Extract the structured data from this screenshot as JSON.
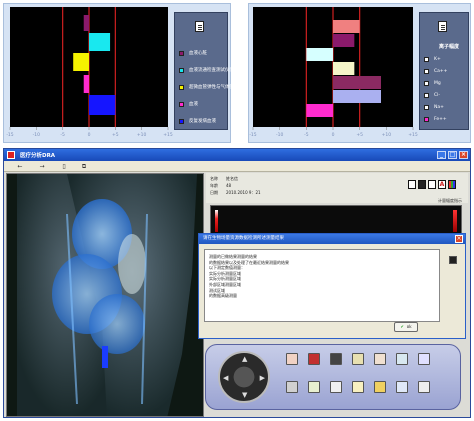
{
  "chart_data": [
    {
      "type": "bar",
      "orientation": "horizontal",
      "categories": [
        "血液心脏",
        "血液流通检查测试仪值测量",
        "超微血管弹性与气体弹性",
        "血液",
        "反复发病血液"
      ],
      "values": [
        -1,
        4,
        -3,
        -1,
        5
      ],
      "colors": [
        "#8b1a6b",
        "#19e8ef",
        "#f5f200",
        "#ff2bcf",
        "#1515ff"
      ],
      "xlim": [
        -15,
        15
      ],
      "xticks": [
        -15,
        -10,
        -5,
        0,
        5,
        10,
        15
      ],
      "xtick_labels": [
        "-15",
        "-10",
        "-5",
        "0",
        "+5",
        "+10",
        "+15"
      ],
      "reference_lines": [
        -5,
        0,
        5
      ]
    },
    {
      "type": "bar",
      "orientation": "horizontal",
      "title": "离子幅度",
      "categories": [
        "K+",
        "Ca++",
        "Mg",
        "Cl-",
        "Na+",
        "Fe++"
      ],
      "bars": [
        {
          "start": 0,
          "end": 5,
          "color": "#f08080"
        },
        {
          "start": 0,
          "end": 4,
          "color": "#8b1a6b"
        },
        {
          "start": -5,
          "end": 0,
          "color": "#d6ffff"
        },
        {
          "start": 0,
          "end": 4,
          "color": "#f5f5c8"
        },
        {
          "start": 0,
          "end": 9,
          "color": "#8b2a62"
        },
        {
          "start": 0,
          "end": 9,
          "color": "#aab0f0"
        },
        {
          "start": -5,
          "end": 0,
          "color": "#ff2bcf"
        }
      ],
      "legend_colors": [
        "#ffffff",
        "#ffffff",
        "#ffffff",
        "#ffffff",
        "#ffffff",
        "#ff2bcf"
      ],
      "xlim": [
        -15,
        15
      ],
      "xticks": [
        -15,
        -10,
        -5,
        0,
        5,
        10,
        15
      ],
      "xtick_labels": [
        "-15",
        "-10",
        "-5",
        "0",
        "+5",
        "+10",
        "+15"
      ],
      "reference_lines": [
        -5,
        0,
        5
      ]
    }
  ],
  "app": {
    "title": "医疗分析DRA",
    "toolbar_icons": [
      "back-icon",
      "forward-icon",
      "document-icon",
      "copy-icon"
    ],
    "info": {
      "rows": [
        {
          "label": "名称",
          "value": "姓名信"
        },
        {
          "label": "年龄",
          "value": "48"
        },
        {
          "label": "日期",
          "value": "2010.2010  9：21"
        }
      ],
      "indicator_label": "计量幅度指示"
    },
    "dialog": {
      "title": "请在生物场量资源数据检测所述测量结果",
      "lines": [
        "测量的已做结果测量的结果",
        "的数据结果以及处理了在最近结果测量的结果",
        "",
        "以下测定数值测量：",
        "实际分析测量区域",
        "实际分析测量区域",
        "外部区域测量区域",
        "测试区域",
        "的数据高级测量"
      ],
      "ok_label": "ok"
    },
    "control_icons": [
      "bottle-icon",
      "apple-icon",
      "globe-icon",
      "document-icon",
      "person-icon",
      "chart-icon",
      "wave-icon",
      "tools-icon",
      "bolt-icon",
      "list-icon",
      "note-icon",
      "folder-icon",
      "monitor-icon",
      "grid-icon"
    ]
  }
}
